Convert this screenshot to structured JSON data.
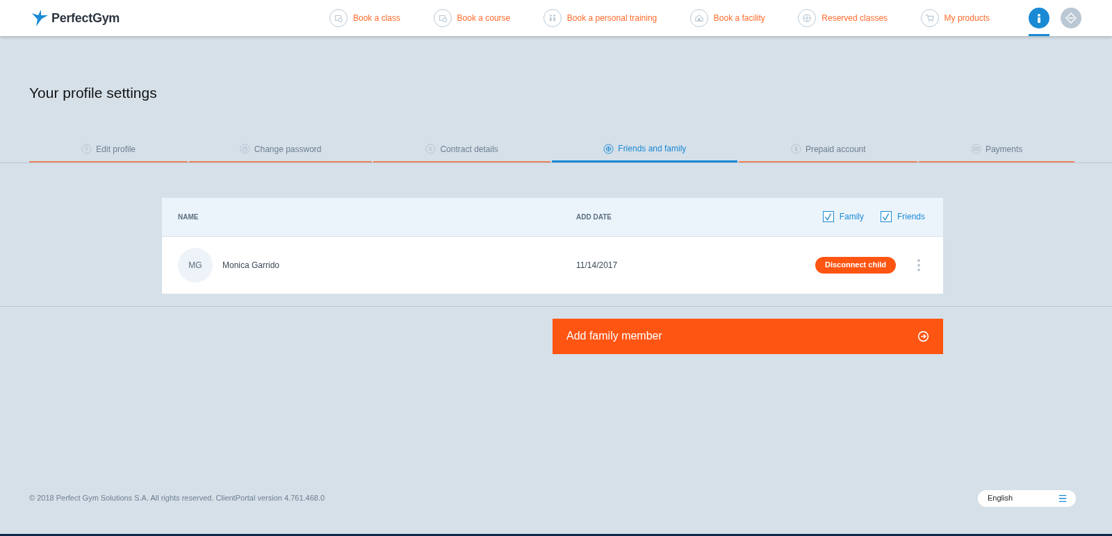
{
  "header": {
    "logo": "PerfectGym",
    "nav": [
      {
        "label": "Book a class"
      },
      {
        "label": "Book a course"
      },
      {
        "label": "Book a personal training"
      },
      {
        "label": "Book a facility"
      },
      {
        "label": "Reserved classes"
      },
      {
        "label": "My products"
      }
    ],
    "profile_button": {
      "selected": true
    }
  },
  "page_title": "Your profile settings",
  "tabs": [
    {
      "label": "Edit profile",
      "selected": false
    },
    {
      "label": "Change password",
      "selected": false
    },
    {
      "label": "Contract details",
      "selected": false
    },
    {
      "label": "Friends and family",
      "selected": true
    },
    {
      "label": "Prepaid account",
      "selected": false
    },
    {
      "label": "Payments",
      "selected": false
    }
  ],
  "table": {
    "columns": [
      "NAME",
      "ADD DATE"
    ],
    "filters": [
      {
        "label": "Family",
        "checked": true
      },
      {
        "label": "Friends",
        "checked": true
      }
    ],
    "rows": [
      {
        "initials": "MG",
        "name": "Monica Garrido",
        "date": "11/14/2017",
        "action": "Disconnect child"
      }
    ]
  },
  "add_button": "Add family member",
  "footer": {
    "copyright": "© 2018 Perfect Gym Solutions S.A. All rights reserved. ClientPortal version 4.761.468.0",
    "language": "English"
  }
}
